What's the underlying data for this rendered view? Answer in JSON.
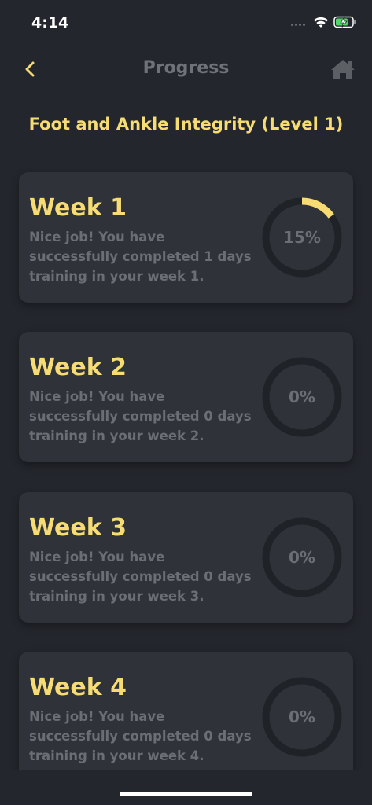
{
  "status_bar": {
    "time": "4:14",
    "signal_icon": "cellular-dots-icon",
    "wifi_icon": "wifi-icon",
    "battery_icon": "battery-charging-icon"
  },
  "nav": {
    "back_icon": "chevron-left-icon",
    "title": "Progress",
    "home_icon": "home-icon"
  },
  "program_title": "Foot and Ankle Integrity (Level 1)",
  "colors": {
    "background": "#23262c",
    "card": "#2f3238",
    "accent": "#f6dc73",
    "muted_text": "#6b6e74",
    "ring_track": "#1f2227"
  },
  "weeks": [
    {
      "label": "Week 1",
      "message": "Nice job! You have successfully completed 1 days training in your week 1.",
      "percent_label": "15%",
      "progress": 0.15
    },
    {
      "label": "Week 2",
      "message": "Nice job! You have successfully completed 0 days training in your week 2.",
      "percent_label": "0%",
      "progress": 0
    },
    {
      "label": "Week 3",
      "message": "Nice job! You have successfully completed 0 days training in your week 3.",
      "percent_label": "0%",
      "progress": 0
    },
    {
      "label": "Week 4",
      "message": "Nice job! You have successfully completed 0 days training in your week 4.",
      "percent_label": "0%",
      "progress": 0
    }
  ]
}
